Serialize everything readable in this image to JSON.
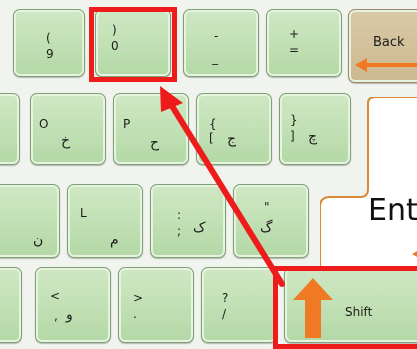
{
  "keyboard": {
    "row_numbers": {
      "key_9": {
        "top": "(",
        "bottom": "9"
      },
      "key_0": {
        "top": ")",
        "bottom": "0"
      },
      "key_minus": {
        "top": "-",
        "bottom": "_"
      },
      "key_equals": {
        "top": "+",
        "bottom": "="
      },
      "key_backspace": {
        "label": "Back"
      }
    },
    "row_qwerty": {
      "key_o": {
        "latin": "O",
        "persian": "خ"
      },
      "key_p": {
        "latin": "P",
        "persian": "ح"
      },
      "key_lbracket": {
        "top": "{",
        "bottom": "[",
        "persian": "ج"
      },
      "key_rbracket": {
        "top": "}",
        "bottom": "]",
        "persian": "چ"
      }
    },
    "row_home": {
      "key_k": {
        "latin": "",
        "persian": "ن"
      },
      "key_l": {
        "latin": "L",
        "persian": "م"
      },
      "key_semicolon": {
        "top": ":",
        "bottom": ";",
        "persian": "ک"
      },
      "key_quote": {
        "top": "\"",
        "persian": "گ"
      },
      "key_enter": {
        "label": "Ent"
      }
    },
    "row_bottom": {
      "key_comma": {
        "top": "<",
        "bottom": ",",
        "persian": "و"
      },
      "key_period": {
        "top": ">",
        "bottom": "."
      },
      "key_slash": {
        "top": "?",
        "bottom": "/"
      },
      "key_shift": {
        "label": "Shift"
      }
    }
  },
  "colors": {
    "key_fill": "#c4e1b7",
    "highlight": "#ee1b1b",
    "arrow_orange": "#f07a24"
  }
}
